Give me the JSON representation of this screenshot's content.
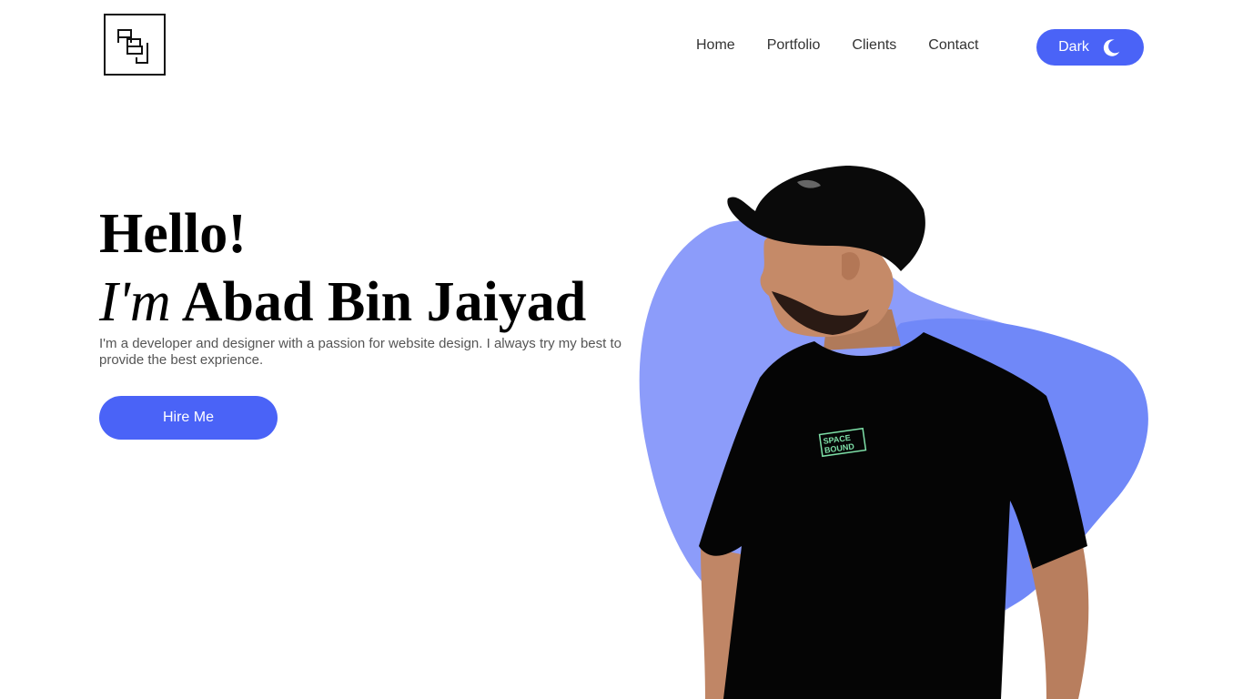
{
  "header": {
    "logo_text": "ABJ",
    "nav": [
      {
        "label": "Home"
      },
      {
        "label": "Portfolio"
      },
      {
        "label": "Clients"
      },
      {
        "label": "Contact"
      }
    ],
    "theme_toggle": {
      "label": "Dark",
      "icon": "moon-icon"
    }
  },
  "hero": {
    "greeting": "Hello!",
    "intro_prefix": "I'm",
    "name": "Abad Bin Jaiyad",
    "description": "I'm a developer and designer with a passion for website design. I always try my best to provide the best exprience.",
    "cta_label": "Hire Me",
    "shirt_text": [
      "SPACE",
      "BOUND"
    ]
  },
  "colors": {
    "accent": "#4a63f7",
    "blob_light": "#8c9cfa",
    "blob_dark": "#7088f8",
    "text_dark": "#000000",
    "text_muted": "#555555"
  }
}
